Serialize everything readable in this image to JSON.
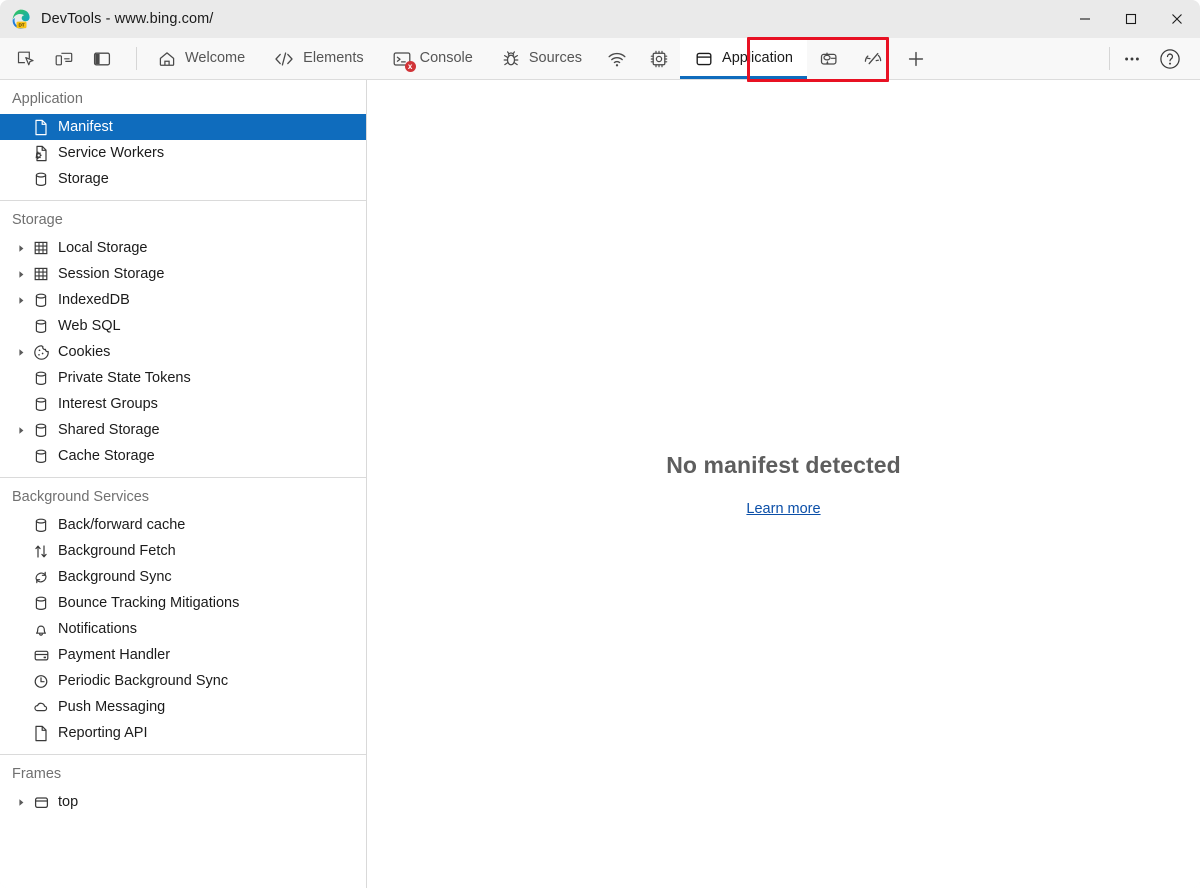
{
  "window": {
    "title": "DevTools - www.bing.com/",
    "logo_icon": "edge-devtools-logo",
    "minimize_label": "Minimize",
    "maximize_label": "Maximize",
    "close_label": "Close"
  },
  "toolbar": {
    "buttons": [
      {
        "name": "inspect-element-button",
        "icon": "inspect-cursor-icon",
        "label": "Inspect element"
      },
      {
        "name": "device-emulation-button",
        "icon": "device-toolbar-icon",
        "label": "Toggle device emulation"
      },
      {
        "name": "dock-side-button",
        "icon": "dock-panel-icon",
        "label": "Dock side"
      }
    ]
  },
  "tabs": [
    {
      "name": "tab-welcome",
      "label": "Welcome",
      "icon": "home-icon",
      "active": false
    },
    {
      "name": "tab-elements",
      "label": "Elements",
      "icon": "code-brackets-icon",
      "active": false
    },
    {
      "name": "tab-console",
      "label": "Console",
      "icon": "console-icon",
      "active": false,
      "error_badge": "x"
    },
    {
      "name": "tab-sources",
      "label": "Sources",
      "icon": "bug-icon",
      "active": false
    },
    {
      "name": "tab-network",
      "label": "",
      "icon": "wifi-icon",
      "active": false
    },
    {
      "name": "tab-performance",
      "label": "",
      "icon": "cpu-chip-icon",
      "active": false
    },
    {
      "name": "tab-application",
      "label": "Application",
      "icon": "frame-window-icon",
      "active": true
    },
    {
      "name": "tab-memory",
      "label": "",
      "icon": "memory-inspector-icon",
      "active": false
    },
    {
      "name": "tab-lighthouse",
      "label": "",
      "icon": "gauge-icon",
      "active": false
    },
    {
      "name": "tab-more-tools",
      "label": "",
      "icon": "plus-icon",
      "active": false
    }
  ],
  "tabs_right": [
    {
      "name": "more-options-button",
      "icon": "ellipsis-icon",
      "label": "Customize and control DevTools"
    },
    {
      "name": "help-button",
      "icon": "question-circle-icon",
      "label": "Help"
    }
  ],
  "highlight": {
    "target": "tab-application",
    "color": "#e81123"
  },
  "accent": {
    "active_tab_underline": "#0f6cbd",
    "selection": "#0f6cbd",
    "link": "#0b4fa8"
  },
  "sidebar": {
    "sections": [
      {
        "name": "section-application",
        "title": "Application",
        "items": [
          {
            "name": "sidebar-item-manifest",
            "label": "Manifest",
            "icon": "document-icon",
            "expandable": false,
            "selected": true
          },
          {
            "name": "sidebar-item-service-workers",
            "label": "Service Workers",
            "icon": "service-worker-icon",
            "expandable": false,
            "selected": false
          },
          {
            "name": "sidebar-item-storage",
            "label": "Storage",
            "icon": "database-icon",
            "expandable": false,
            "selected": false
          }
        ]
      },
      {
        "name": "section-storage",
        "title": "Storage",
        "items": [
          {
            "name": "sidebar-item-local-storage",
            "label": "Local Storage",
            "icon": "table-grid-icon",
            "expandable": true,
            "selected": false
          },
          {
            "name": "sidebar-item-session-storage",
            "label": "Session Storage",
            "icon": "table-grid-icon",
            "expandable": true,
            "selected": false
          },
          {
            "name": "sidebar-item-indexeddb",
            "label": "IndexedDB",
            "icon": "database-icon",
            "expandable": true,
            "selected": false
          },
          {
            "name": "sidebar-item-web-sql",
            "label": "Web SQL",
            "icon": "database-icon",
            "expandable": false,
            "selected": false
          },
          {
            "name": "sidebar-item-cookies",
            "label": "Cookies",
            "icon": "cookie-icon",
            "expandable": true,
            "selected": false
          },
          {
            "name": "sidebar-item-private-state-tokens",
            "label": "Private State Tokens",
            "icon": "database-icon",
            "expandable": false,
            "selected": false
          },
          {
            "name": "sidebar-item-interest-groups",
            "label": "Interest Groups",
            "icon": "database-icon",
            "expandable": false,
            "selected": false
          },
          {
            "name": "sidebar-item-shared-storage",
            "label": "Shared Storage",
            "icon": "database-icon",
            "expandable": true,
            "selected": false
          },
          {
            "name": "sidebar-item-cache-storage",
            "label": "Cache Storage",
            "icon": "database-icon",
            "expandable": false,
            "selected": false
          }
        ]
      },
      {
        "name": "section-background-services",
        "title": "Background Services",
        "items": [
          {
            "name": "sidebar-item-back-forward-cache",
            "label": "Back/forward cache",
            "icon": "database-icon",
            "expandable": false,
            "selected": false
          },
          {
            "name": "sidebar-item-background-fetch",
            "label": "Background Fetch",
            "icon": "up-down-arrows-icon",
            "expandable": false,
            "selected": false
          },
          {
            "name": "sidebar-item-background-sync",
            "label": "Background Sync",
            "icon": "sync-circle-icon",
            "expandable": false,
            "selected": false
          },
          {
            "name": "sidebar-item-bounce-tracking-mitigations",
            "label": "Bounce Tracking Mitigations",
            "icon": "database-icon",
            "expandable": false,
            "selected": false
          },
          {
            "name": "sidebar-item-notifications",
            "label": "Notifications",
            "icon": "bell-icon",
            "expandable": false,
            "selected": false
          },
          {
            "name": "sidebar-item-payment-handler",
            "label": "Payment Handler",
            "icon": "credit-card-icon",
            "expandable": false,
            "selected": false
          },
          {
            "name": "sidebar-item-periodic-background-sync",
            "label": "Periodic Background Sync",
            "icon": "clock-icon",
            "expandable": false,
            "selected": false
          },
          {
            "name": "sidebar-item-push-messaging",
            "label": "Push Messaging",
            "icon": "cloud-icon",
            "expandable": false,
            "selected": false
          },
          {
            "name": "sidebar-item-reporting-api",
            "label": "Reporting API",
            "icon": "document-icon",
            "expandable": false,
            "selected": false
          }
        ]
      },
      {
        "name": "section-frames",
        "title": "Frames",
        "items": [
          {
            "name": "sidebar-item-top-frame",
            "label": "top",
            "icon": "frame-window-icon",
            "expandable": true,
            "selected": false
          }
        ]
      }
    ]
  },
  "main": {
    "empty_state_title": "No manifest detected",
    "empty_state_link": "Learn more"
  }
}
